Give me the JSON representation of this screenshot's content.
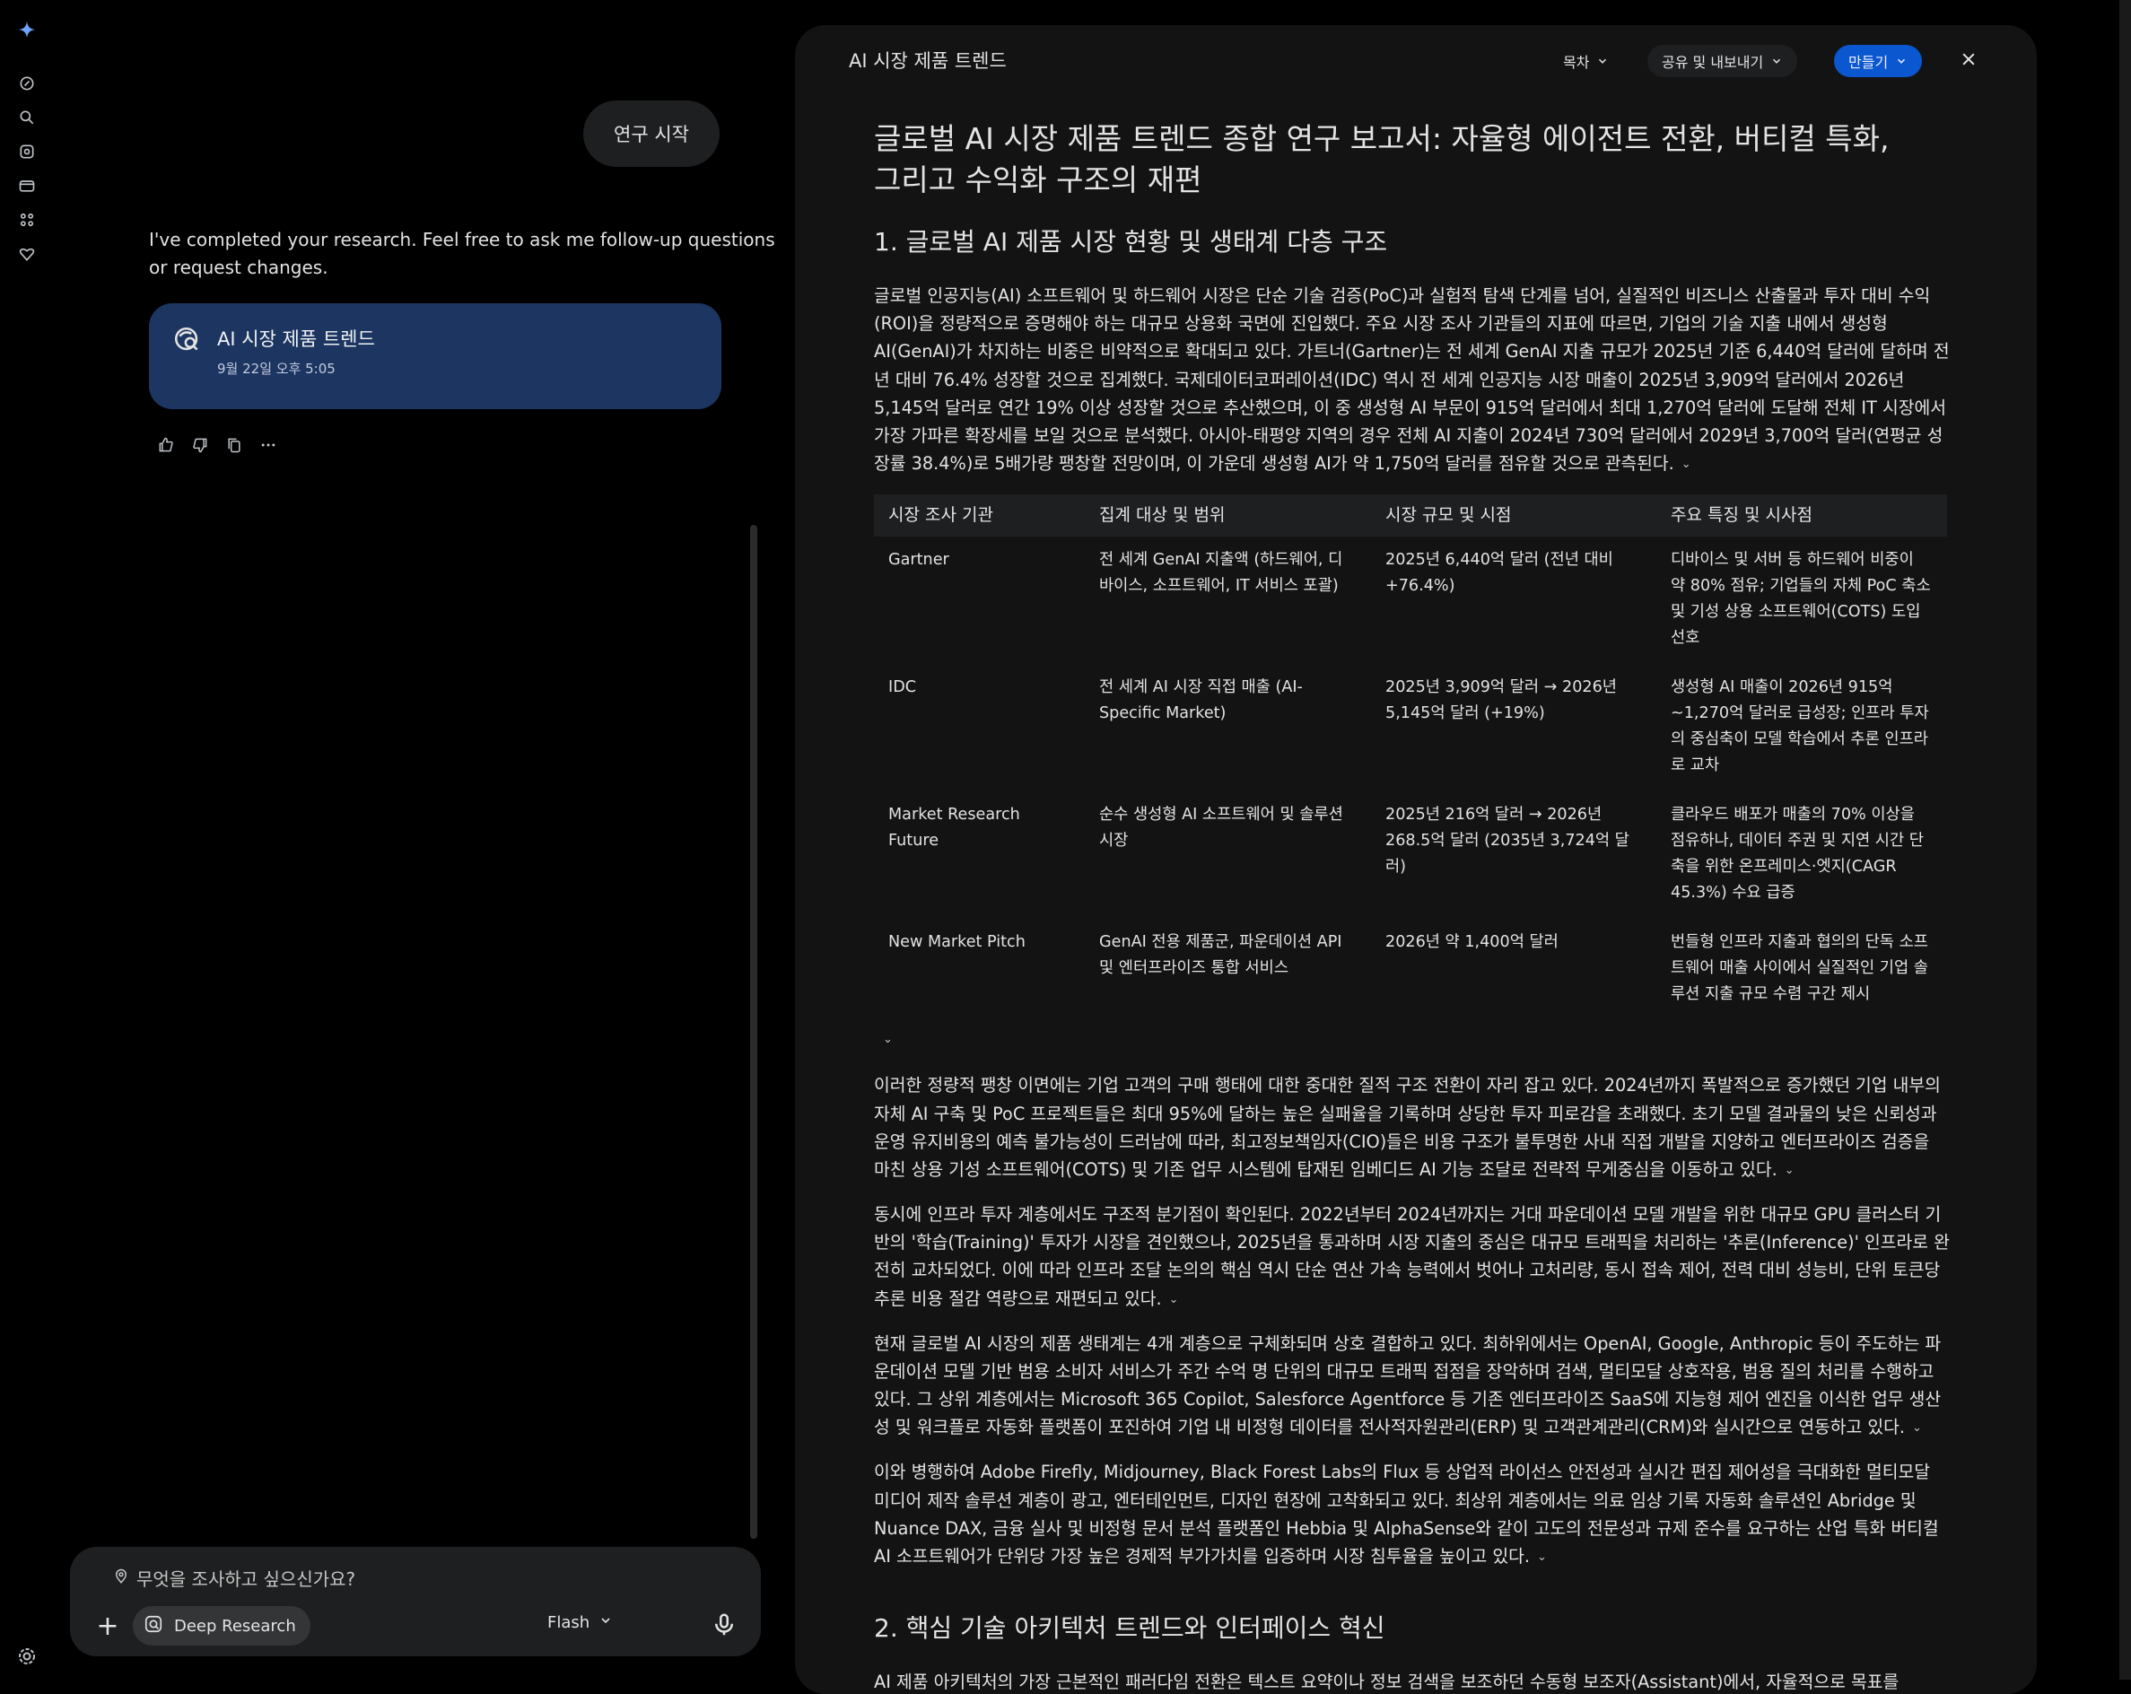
{
  "chat": {
    "start_button": "연구 시작",
    "completed_message": "I've completed your research. Feel free to ask me follow-up questions or request changes.",
    "research_card": {
      "title": "AI 시장 제품 트렌드",
      "date": "9월 22일 오후 5:05"
    }
  },
  "composer": {
    "placeholder": "무엇을 조사하고 싶으신가요?",
    "deep_research_label": "Deep Research",
    "model_label": "Flash"
  },
  "panel": {
    "title": "AI 시장 제품 트렌드",
    "toc_label": "목차",
    "share_label": "공유 및 내보내기",
    "create_label": "만들기"
  },
  "report": {
    "title": "글로벌 AI 시장 제품 트렌드 종합 연구 보고서: 자율형 에이전트 전환, 버티컬 특화, 그리고 수익화 구조의 재편",
    "section1_heading": "1. 글로벌 AI 제품 시장 현황 및 생태계 다층 구조",
    "para1": "글로벌 인공지능(AI) 소프트웨어 및 하드웨어 시장은 단순 기술 검증(PoC)과 실험적 탐색 단계를 넘어, 실질적인 비즈니스 산출물과 투자 대비 수익(ROI)을 정량적으로 증명해야 하는 대규모 상용화 국면에 진입했다. 주요 시장 조사 기관들의 지표에 따르면, 기업의 기술 지출 내에서 생성형 AI(GenAI)가 차지하는 비중은 비약적으로 확대되고 있다. 가트너(Gartner)는 전 세계 GenAI 지출 규모가 2025년 기준 6,440억 달러에 달하며 전년 대비 76.4% 성장할 것으로 집계했다. 국제데이터코퍼레이션(IDC) 역시 전 세계 인공지능 시장 매출이 2025년 3,909억 달러에서 2026년 5,145억 달러로 연간 19% 이상 성장할 것으로 추산했으며, 이 중 생성형 AI 부문이 915억 달러에서 최대 1,270억 달러에 도달해 전체 IT 시장에서 가장 가파른 확장세를 보일 것으로 분석했다. 아시아-태평양 지역의 경우 전체 AI 지출이 2024년 730억 달러에서 2029년 3,700억 달러(연평균 성장률 38.4%)로 5배가량 팽창할 전망이며, 이 가운데 생성형 AI가 약 1,750억 달러를 점유할 것으로 관측된다.",
    "table": {
      "headers": [
        "시장 조사 기관",
        "집계 대상 및 범위",
        "시장 규모 및 시점",
        "주요 특징 및 시사점"
      ],
      "rows": [
        [
          "Gartner",
          "전 세계 GenAI 지출액 (하드웨어, 디바이스, 소프트웨어, IT 서비스 포괄)",
          "2025년 6,440억 달러 (전년 대비 +76.4%)",
          "디바이스 및 서버 등 하드웨어 비중이 약 80% 점유; 기업들의 자체 PoC 축소 및 기성 상용 소프트웨어(COTS) 도입 선호"
        ],
        [
          "IDC",
          "전 세계 AI 시장 직접 매출 (AI-Specific Market)",
          "2025년 3,909억 달러 → 2026년 5,145억 달러 (+19%)",
          "생성형 AI 매출이 2026년 915억~1,270억 달러로 급성장; 인프라 투자의 중심축이 모델 학습에서 추론 인프라로 교차"
        ],
        [
          "Market Research Future",
          "순수 생성형 AI 소프트웨어 및 솔루션 시장",
          "2025년 216억 달러 → 2026년 268.5억 달러 (2035년 3,724억 달러)",
          "클라우드 배포가 매출의 70% 이상을 점유하나, 데이터 주권 및 지연 시간 단축을 위한 온프레미스·엣지(CAGR 45.3%) 수요 급증"
        ],
        [
          "New Market Pitch",
          "GenAI 전용 제품군, 파운데이션 API 및 엔터프라이즈 통합 서비스",
          "2026년 약 1,400억 달러",
          "번들형 인프라 지출과 협의의 단독 소프트웨어 매출 사이에서 실질적인 기업 솔루션 지출 규모 수렴 구간 제시"
        ]
      ]
    },
    "para2": "이러한 정량적 팽창 이면에는 기업 고객의 구매 행태에 대한 중대한 질적 구조 전환이 자리 잡고 있다. 2024년까지 폭발적으로 증가했던 기업 내부의 자체 AI 구축 및 PoC 프로젝트들은 최대 95%에 달하는 높은 실패율을 기록하며 상당한 투자 피로감을 초래했다. 초기 모델 결과물의 낮은 신뢰성과 운영 유지비용의 예측 불가능성이 드러남에 따라, 최고정보책임자(CIO)들은 비용 구조가 불투명한 사내 직접 개발을 지양하고 엔터프라이즈 검증을 마친 상용 기성 소프트웨어(COTS) 및 기존 업무 시스템에 탑재된 임베디드 AI 기능 조달로 전략적 무게중심을 이동하고 있다.",
    "para3": "동시에 인프라 투자 계층에서도 구조적 분기점이 확인된다. 2022년부터 2024년까지는 거대 파운데이션 모델 개발을 위한 대규모 GPU 클러스터 기반의 '학습(Training)' 투자가 시장을 견인했으나, 2025년을 통과하며 시장 지출의 중심은 대규모 트래픽을 처리하는 '추론(Inference)' 인프라로 완전히 교차되었다. 이에 따라 인프라 조달 논의의 핵심 역시 단순 연산 가속 능력에서 벗어나 고처리량, 동시 접속 제어, 전력 대비 성능비, 단위 토큰당 추론 비용 절감 역량으로 재편되고 있다.",
    "para4": "현재 글로벌 AI 시장의 제품 생태계는 4개 계층으로 구체화되며 상호 결합하고 있다. 최하위에서는 OpenAI, Google, Anthropic 등이 주도하는 파운데이션 모델 기반 범용 소비자 서비스가 주간 수억 명 단위의 대규모 트래픽 접점을 장악하며 검색, 멀티모달 상호작용, 범용 질의 처리를 수행하고 있다. 그 상위 계층에서는 Microsoft 365 Copilot, Salesforce Agentforce 등 기존 엔터프라이즈 SaaS에 지능형 제어 엔진을 이식한 업무 생산성 및 워크플로 자동화 플랫폼이 포진하여 기업 내 비정형 데이터를 전사적자원관리(ERP) 및 고객관계관리(CRM)와 실시간으로 연동하고 있다.",
    "para5": "이와 병행하여 Adobe Firefly, Midjourney, Black Forest Labs의 Flux 등 상업적 라이선스 안전성과 실시간 편집 제어성을 극대화한 멀티모달 미디어 제작 솔루션 계층이 광고, 엔터테인먼트, 디자인 현장에 고착화되고 있다. 최상위 계층에서는 의료 임상 기록 자동화 솔루션인 Abridge 및 Nuance DAX, 금융 실사 및 비정형 문서 분석 플랫폼인 Hebbia 및 AlphaSense와 같이 고도의 전문성과 규제 준수를 요구하는 산업 특화 버티컬 AI 소프트웨어가 단위당 가장 높은 경제적 부가가치를 입증하며 시장 침투율을 높이고 있다.",
    "section2_heading": "2. 핵심 기술 아키텍처 트렌드와 인터페이스 혁신",
    "para6": "AI 제품 아키텍처의 가장 근본적인 패러다임 전환은 텍스트 요약이나 정보 검색을 보조하던 수동형 보조자(Assistant)에서, 자율적으로 목표를"
  },
  "colors": {
    "background": "#000000",
    "panel": "#131314",
    "card": "#1c3561",
    "create_button": "#0b57d0"
  },
  "icons": [
    "gemini-spark-icon",
    "edit-icon",
    "search-icon",
    "explore-icon",
    "folder-icon",
    "apps-icon",
    "heart-icon",
    "settings-icon",
    "research-icon",
    "thumbs-up-icon",
    "thumbs-down-icon",
    "copy-icon",
    "more-icon",
    "location-icon",
    "plus-icon",
    "mic-icon",
    "chevron-down-icon",
    "close-icon"
  ]
}
